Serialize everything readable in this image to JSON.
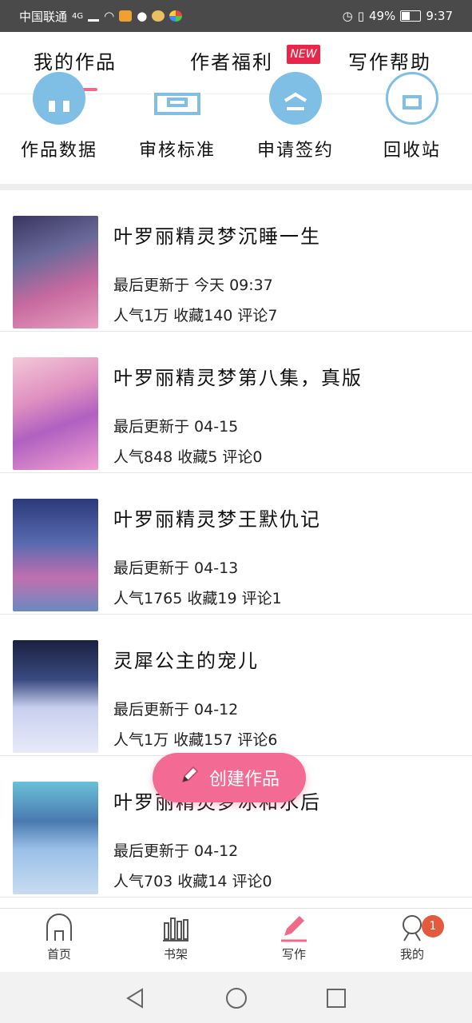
{
  "status_bar": {
    "carrier": "中国联通",
    "network": "4G",
    "battery": "49%",
    "time": "9:37"
  },
  "top_tabs": [
    {
      "label": "我的作品",
      "active": true
    },
    {
      "label": "作者福利",
      "badge": "NEW"
    },
    {
      "label": "写作帮助"
    }
  ],
  "quick_actions": [
    {
      "label": "作品数据",
      "icon": "chart-icon"
    },
    {
      "label": "审核标准",
      "icon": "review-icon"
    },
    {
      "label": "申请签约",
      "icon": "sign-icon"
    },
    {
      "label": "回收站",
      "icon": "trash-icon"
    }
  ],
  "works": [
    {
      "title": "叶罗丽精灵梦沉睡一生",
      "updated": "最后更新于 今天 09:37",
      "stats": "人气1万 收藏140 评论7"
    },
    {
      "title": "叶罗丽精灵梦第八集，真版",
      "updated": "最后更新于 04-15",
      "stats": "人气848 收藏5 评论0"
    },
    {
      "title": "叶罗丽精灵梦王默仇记",
      "updated": "最后更新于 04-13",
      "stats": "人气1765 收藏19 评论1"
    },
    {
      "title": "灵犀公主的宠儿",
      "updated": "最后更新于 04-12",
      "stats": "人气1万 收藏157 评论6"
    },
    {
      "title": "叶罗丽精灵梦冰和水后",
      "updated": "最后更新于 04-12",
      "stats": "人气703 收藏14 评论0"
    }
  ],
  "fab": {
    "label": "创建作品"
  },
  "bottom_nav": [
    {
      "label": "首页",
      "icon": "home-icon"
    },
    {
      "label": "书架",
      "icon": "bookshelf-icon"
    },
    {
      "label": "写作",
      "icon": "pen-icon",
      "active": true
    },
    {
      "label": "我的",
      "icon": "profile-icon",
      "badge": "1"
    }
  ],
  "colors": {
    "accent": "#f06a8a",
    "new_badge": "#e8264a",
    "quick_icon": "#7fbfe6",
    "notification": "#e45a3c"
  }
}
